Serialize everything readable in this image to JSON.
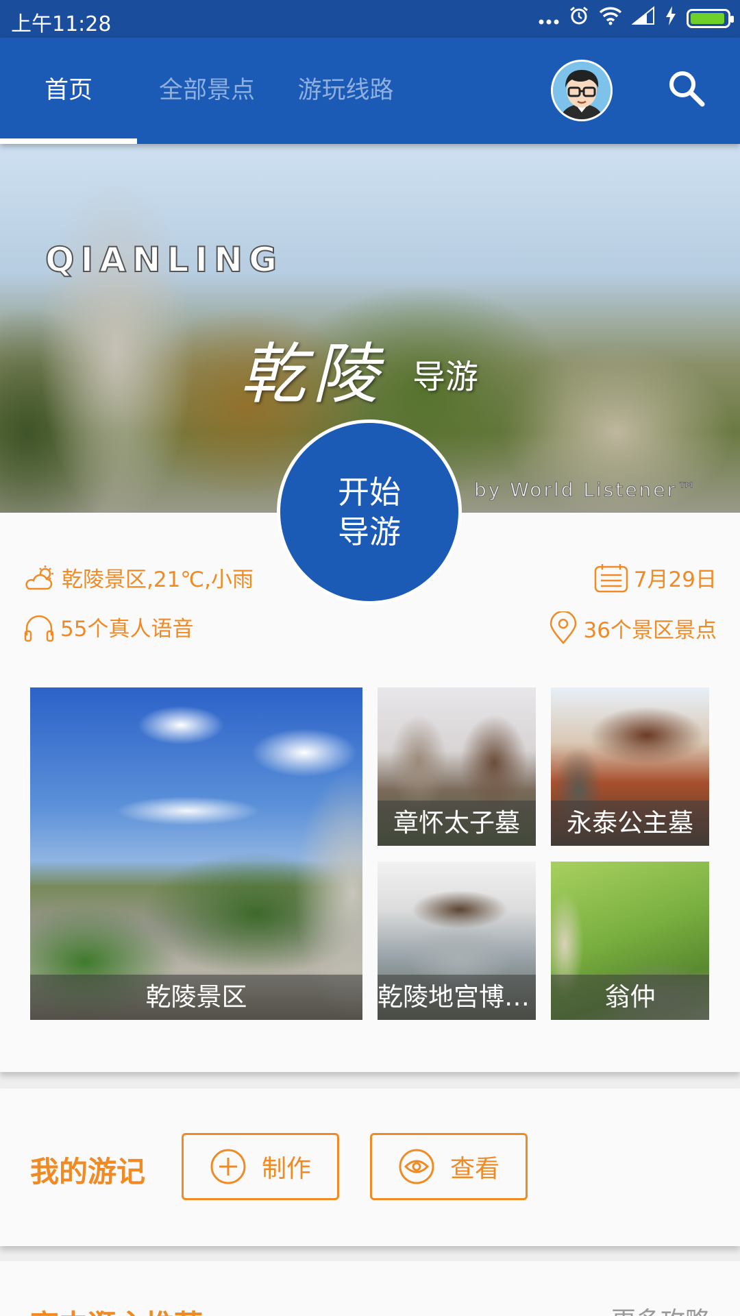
{
  "status_bar": {
    "time": "上午11:28",
    "battery_level": 0.9,
    "icons": [
      "more-icon",
      "alarm-icon",
      "wifi-icon",
      "signal-icon",
      "charging-icon",
      "battery-icon"
    ]
  },
  "nav": {
    "tabs": [
      {
        "label": "首页",
        "active": true
      },
      {
        "label": "全部景点",
        "active": false
      },
      {
        "label": "游玩线路",
        "active": false
      }
    ]
  },
  "banner": {
    "latin_title": "QIANLING",
    "title": "乾陵",
    "subtitle": "导游",
    "byline": "by World Listener™"
  },
  "start_button": {
    "line1": "开始",
    "line2": "导游"
  },
  "info": {
    "weather": "乾陵景区,21℃,小雨",
    "voice_count": "55个真人语音",
    "date": "7月29日",
    "spots_count": "36个景区景点"
  },
  "attractions": [
    {
      "name": "乾陵景区"
    },
    {
      "name": "章怀太子墓"
    },
    {
      "name": "永泰公主墓"
    },
    {
      "name": "乾陵地宫博物馆"
    },
    {
      "name": "翁仲"
    }
  ],
  "travel_notes": {
    "title": "我的游记",
    "make_label": "制作",
    "view_label": "查看"
  },
  "recommend": {
    "title": "离中逛主推荐",
    "more": "更多攻略"
  },
  "colors": {
    "primary": "#1b5bb6",
    "status_bar": "#1a4d9c",
    "accent": "#f08a24"
  }
}
